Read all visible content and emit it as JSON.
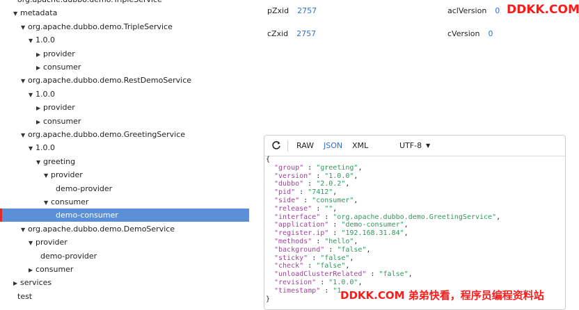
{
  "tree": [
    {
      "label": "org.apache.dubbo.demo.TripleService",
      "expanded": null,
      "level": 0,
      "partial": true
    },
    {
      "label": "metadata",
      "expanded": true,
      "level": 0
    },
    {
      "label": "org.apache.dubbo.demo.TripleService",
      "expanded": true,
      "level": 1
    },
    {
      "label": "1.0.0",
      "expanded": true,
      "level": 2
    },
    {
      "label": "provider",
      "expanded": false,
      "level": 3
    },
    {
      "label": "consumer",
      "expanded": false,
      "level": 3
    },
    {
      "label": "org.apache.dubbo.demo.RestDemoService",
      "expanded": true,
      "level": 1
    },
    {
      "label": "1.0.0",
      "expanded": true,
      "level": 2
    },
    {
      "label": "provider",
      "expanded": false,
      "level": 3
    },
    {
      "label": "consumer",
      "expanded": false,
      "level": 3
    },
    {
      "label": "org.apache.dubbo.demo.GreetingService",
      "expanded": true,
      "level": 1
    },
    {
      "label": "1.0.0",
      "expanded": true,
      "level": 2
    },
    {
      "label": "greeting",
      "expanded": true,
      "level": 3
    },
    {
      "label": "provider",
      "expanded": true,
      "level": 4
    },
    {
      "label": "demo-provider",
      "expanded": null,
      "level": 5
    },
    {
      "label": "consumer",
      "expanded": true,
      "level": 4
    },
    {
      "label": "demo-consumer",
      "expanded": null,
      "level": 5,
      "selected": true
    },
    {
      "label": "org.apache.dubbo.demo.DemoService",
      "expanded": true,
      "level": 1
    },
    {
      "label": "provider",
      "expanded": true,
      "level": 2
    },
    {
      "label": "demo-provider",
      "expanded": null,
      "level": 3
    },
    {
      "label": "consumer",
      "expanded": false,
      "level": 2
    },
    {
      "label": "services",
      "expanded": false,
      "level": 0
    },
    {
      "label": "test",
      "expanded": null,
      "level": 0
    }
  ],
  "stats": {
    "pzxid_label": "pZxid",
    "pzxid_value": "2757",
    "czxid_label": "cZxid",
    "czxid_value": "2757",
    "aclversion_label": "aclVersion",
    "aclversion_value": "0",
    "cversion_label": "cVersion",
    "cversion_value": "0"
  },
  "watermark": {
    "top_right": "DDKK.COM",
    "bottom": "DDKK.COM 弟弟快看，程序员编程资料站"
  },
  "viewer": {
    "tabs": [
      "RAW",
      "JSON",
      "XML"
    ],
    "active_tab": "JSON",
    "encoding": "UTF-8",
    "open_brace": "{",
    "close_brace": "}",
    "lines": [
      {
        "k": "\"group\"",
        "v": "\"greeting\""
      },
      {
        "k": "\"version\"",
        "v": "\"1.0.0\""
      },
      {
        "k": "\"dubbo\"",
        "v": "\"2.0.2\""
      },
      {
        "k": "\"pid\"",
        "v": "\"7412\""
      },
      {
        "k": "\"side\"",
        "v": "\"consumer\""
      },
      {
        "k": "\"release\"",
        "v": "\"\""
      },
      {
        "k": "\"interface\"",
        "v": "\"org.apache.dubbo.demo.GreetingService\""
      },
      {
        "k": "\"application\"",
        "v": "\"demo-consumer\""
      },
      {
        "k": "\"register.ip\"",
        "v": "\"192.168.31.84\""
      },
      {
        "k": "\"methods\"",
        "v": "\"hello\""
      },
      {
        "k": "\"background\"",
        "v": "\"false\""
      },
      {
        "k": "\"sticky\"",
        "v": "\"false\""
      },
      {
        "k": "\"check\"",
        "v": "\"false\""
      },
      {
        "k": "\"unloadClusterRelated\"",
        "v": "\"false\""
      },
      {
        "k": "\"revision\"",
        "v": "\"1.0.0\""
      },
      {
        "k": "\"timestamp\"",
        "v": "\"1"
      }
    ]
  },
  "icons": {
    "refresh": "refresh-icon",
    "caret": "chevron-down-icon",
    "expanded": "triangle-down-icon",
    "collapsed": "triangle-right-icon"
  },
  "colors": {
    "accent": "#2f6fd0",
    "selection": "#5b8fd8",
    "watermark": "#ff1a1a",
    "json_key": "#a0409a",
    "json_value": "#2a9a57"
  }
}
